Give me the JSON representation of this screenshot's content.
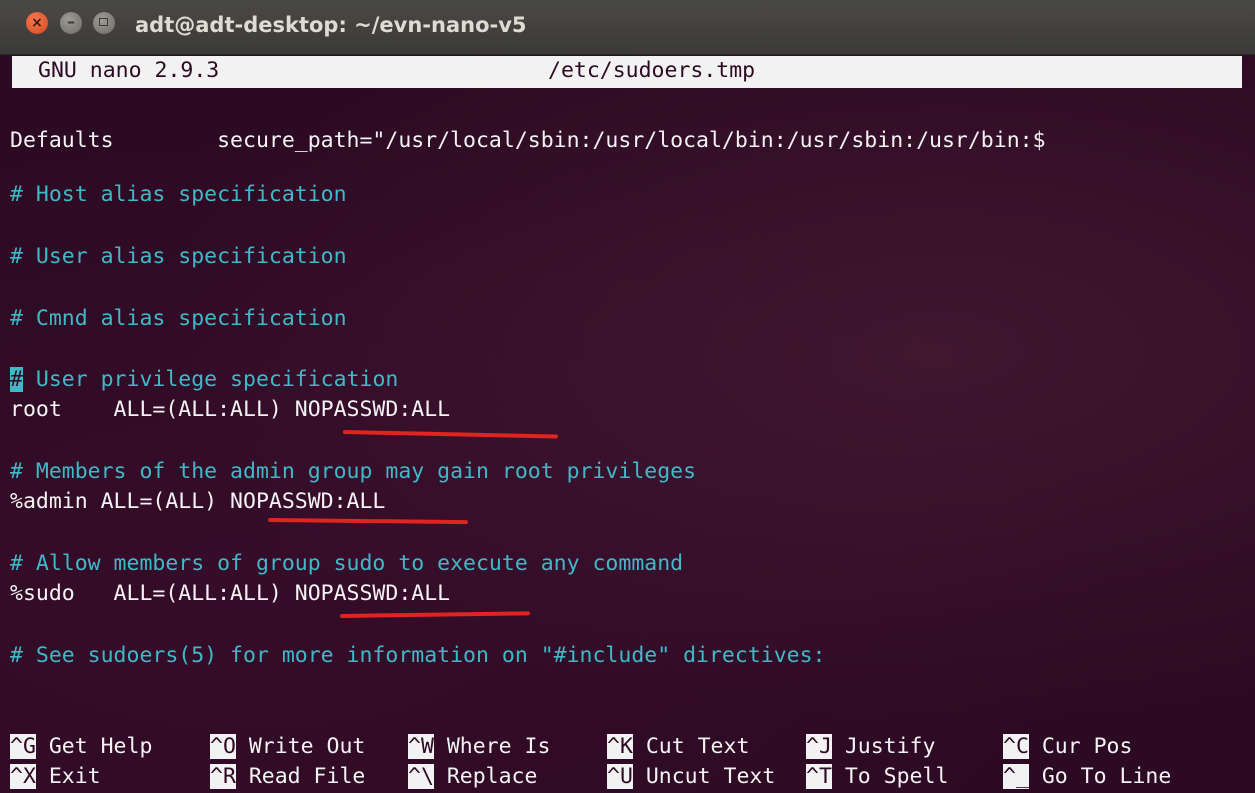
{
  "window": {
    "title": "adt@adt-desktop: ~/evn-nano-v5"
  },
  "nano": {
    "version": "GNU nano 2.9.3",
    "filename": "/etc/sudoers.tmp"
  },
  "editor_lines": {
    "defaults": "Defaults        secure_path=\"/usr/local/sbin:/usr/local/bin:/usr/sbin:/usr/bin:$",
    "host_alias": "# Host alias specification",
    "user_alias": "# User alias specification",
    "cmnd_alias": "# Cmnd alias specification",
    "user_priv_cursor": "#",
    "user_priv_rest": " User privilege specification",
    "root_line": "root    ALL=(ALL:ALL) NOPASSWD:ALL",
    "admin_comment": "# Members of the admin group may gain root privileges",
    "admin_line": "%admin ALL=(ALL) NOPASSWD:ALL",
    "sudo_comment": "# Allow members of group sudo to execute any command",
    "sudo_line": "%sudo   ALL=(ALL:ALL) NOPASSWD:ALL",
    "include_comment": "# See sudoers(5) for more information on \"#include\" directives:"
  },
  "shortcuts": {
    "row1": [
      {
        "key": "^G",
        "label": " Get Help"
      },
      {
        "key": "^O",
        "label": " Write Out"
      },
      {
        "key": "^W",
        "label": " Where Is"
      },
      {
        "key": "^K",
        "label": " Cut Text"
      },
      {
        "key": "^J",
        "label": " Justify"
      },
      {
        "key": "^C",
        "label": " Cur Pos"
      }
    ],
    "row2": [
      {
        "key": "^X",
        "label": " Exit"
      },
      {
        "key": "^R",
        "label": " Read File"
      },
      {
        "key": "^\\",
        "label": " Replace"
      },
      {
        "key": "^U",
        "label": " Uncut Text"
      },
      {
        "key": "^T",
        "label": " To Spell"
      },
      {
        "key": "^_",
        "label": " Go To Line"
      }
    ]
  },
  "colors": {
    "terminal_bg": "#2d0a23",
    "comment": "#40b8c8",
    "annotation_underline": "#e0241f"
  }
}
